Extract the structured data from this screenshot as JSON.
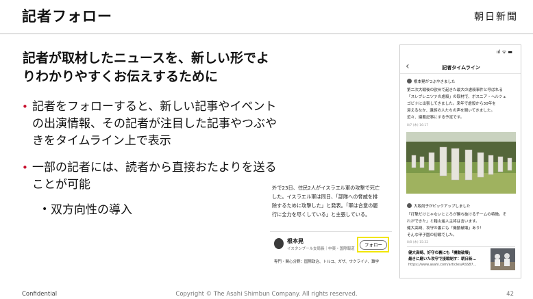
{
  "header": {
    "title": "記者フォロー",
    "brand": "朝日新聞"
  },
  "main": {
    "heading_line1": "記者が取材したニュースを、新しい形でよ",
    "heading_line2": "りわかりやすくお伝えするために",
    "bullets": [
      {
        "line1": "記者をフォローすると、新しい記事やイベント",
        "line2": "の出演情報、その記者が注目した記事やつぶや",
        "line3": "きをタイムライン上で表示"
      },
      {
        "line1": "一部の記者には、読者から直接おたよりを送る",
        "line2": "ことが可能"
      }
    ],
    "sub_bullet": "双方向性の導入",
    "bullet_marker": "•"
  },
  "article": {
    "line1": "外で23日、住民2人がイスラエル軍の攻撃で死亡",
    "line2": "した。イスラエル軍は同日、「部隊への脅威を排",
    "line3": "除するために攻撃した」と発表。「軍は合意の履",
    "line4": "行に全力を尽くしている」と主張している。",
    "reporter_name": "根本晃",
    "reporter_role": "イスタンブール支局長｜中東・国際報道",
    "follow_label": "フォロー",
    "fields": "専門・関心分野：国際政治、トルコ、ガザ、ウクライナ、難学"
  },
  "phone": {
    "status": "ııl ᯤ ▬",
    "back_icon": "‹",
    "nav_title": "記者タイムライン",
    "post1": {
      "author": "根本晃がつぶやきました",
      "line1": "第二次大戦後の欧州で起きた最大の虐殺事件と呼ばれる",
      "line2": "「スレブレニツァの虐殺」の取材で、ボスニア・ヘルツェ",
      "line3": "ゴビナに出張してきました。来年で虐殺から30年を",
      "line4": "迎えるなか、遺族の人たちの声を聞いてきました。",
      "line5": "近々、連載記事にする予定です。",
      "time": "8/7 (木) 16:17"
    },
    "post2": {
      "author": "大坂尚子がピックアップしました",
      "line1": "「打撃だけじゃないところが勝ち抜けるチームの特徴。そ",
      "line2": "れができた」と箱山遥人主将は言います。",
      "line3": "健大高崎、攻守の裏にも「機動破壊」あり！",
      "line4": "そんな甲子園の初戦でした。",
      "time": "8/8 (木) 15:32"
    },
    "link": {
      "title_line1": "健大高崎、好守の裏にも「機動破壊」",
      "title_line2": "最きに磨いた攻守で接戦制す：朝日新…",
      "url": "https://www.asahi.com/articles/ASS87..."
    }
  },
  "footer": {
    "confidential": "Confidential",
    "copyright": "Copyright © The Asahi Shimbun Company. All rights reserved.",
    "page_number": "42"
  },
  "colors": {
    "bullet": "#c8102e",
    "highlight": "#f2e600"
  }
}
